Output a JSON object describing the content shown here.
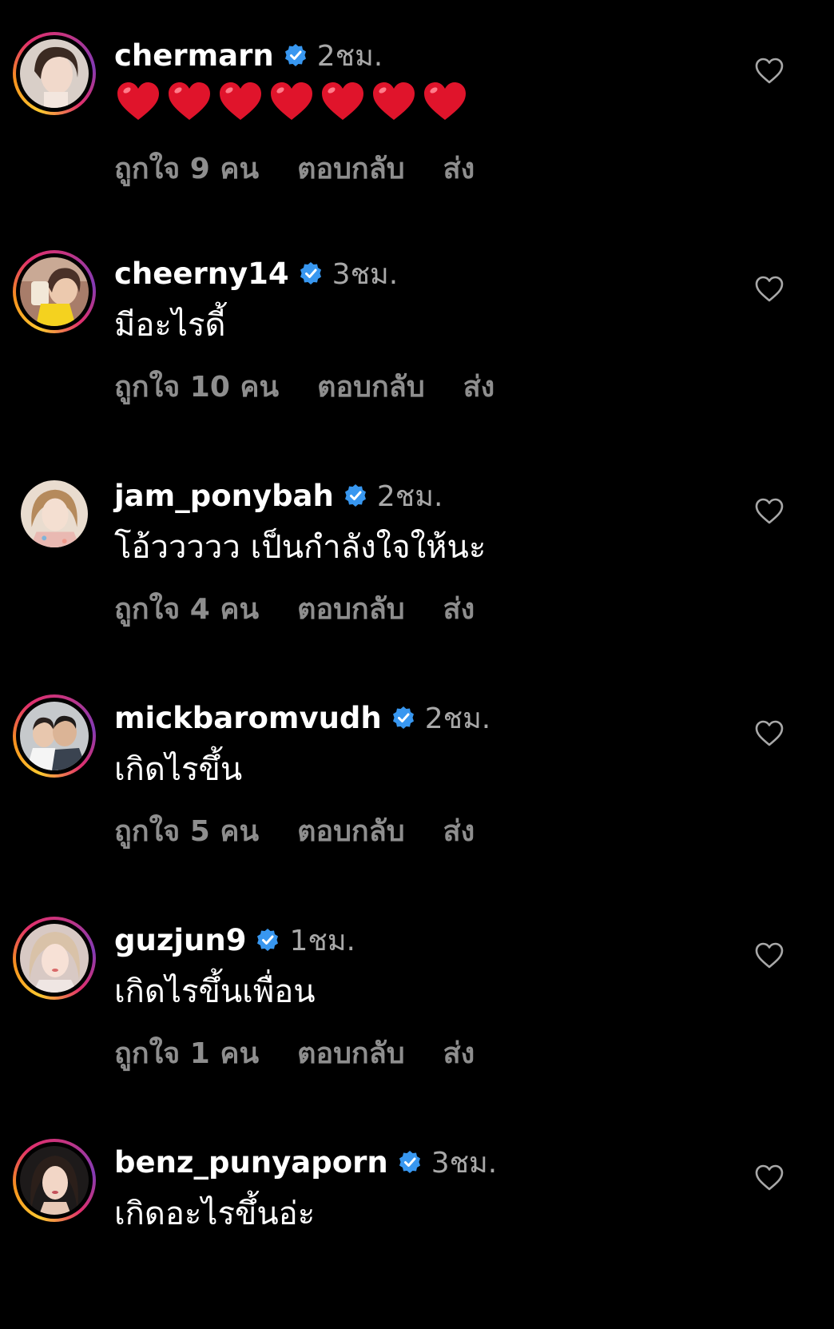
{
  "comments": [
    {
      "username": "chermarn",
      "time": "2ชม.",
      "text": "",
      "hearts": 7,
      "likes": "ถูกใจ 9 คน",
      "reply": "ตอบกลับ",
      "send": "ส่ง",
      "story_ring": true
    },
    {
      "username": "cheerny14",
      "time": "3ชม.",
      "text": "มีอะไรดี้",
      "likes": "ถูกใจ 10 คน",
      "reply": "ตอบกลับ",
      "send": "ส่ง",
      "story_ring": true
    },
    {
      "username": "jam_ponybah",
      "time": "2ชม.",
      "text": "โอ้ววววว เป็นกำลังใจให้นะ",
      "likes": "ถูกใจ 4 คน",
      "reply": "ตอบกลับ",
      "send": "ส่ง",
      "story_ring": false
    },
    {
      "username": "mickbaromvudh",
      "time": "2ชม.",
      "text": "เกิดไรขึ้น",
      "likes": "ถูกใจ 5 คน",
      "reply": "ตอบกลับ",
      "send": "ส่ง",
      "story_ring": true
    },
    {
      "username": "guzjun9",
      "time": "1ชม.",
      "text": "เกิดไรขึ้นเพื่อน",
      "likes": "ถูกใจ 1 คน",
      "reply": "ตอบกลับ",
      "send": "ส่ง",
      "story_ring": true
    },
    {
      "username": "benz_punyaporn",
      "time": "3ชม.",
      "text": "เกิดอะไรขึ้นอ่ะ",
      "likes": "",
      "reply": "",
      "send": "",
      "story_ring": true
    }
  ],
  "colors": {
    "background": "#000000",
    "username": "#ffffff",
    "time": "#a8a8a8",
    "actions": "#8e8e8e",
    "verified": "#3897f0",
    "heart": "#e0142b"
  },
  "icons": {
    "verified": "verified-badge-icon",
    "like": "heart-outline-icon",
    "emoji": "red-heart-emoji"
  }
}
